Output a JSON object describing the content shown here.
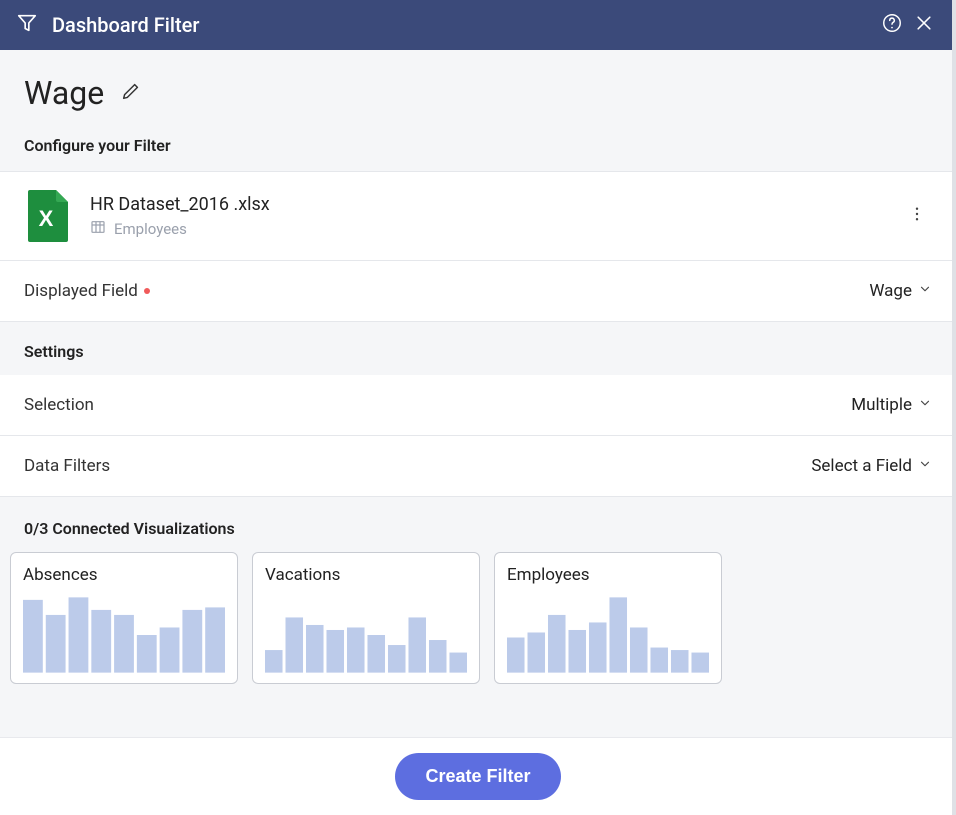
{
  "header": {
    "title": "Dashboard Filter"
  },
  "filter": {
    "name": "Wage",
    "configure_label": "Configure your Filter"
  },
  "data_source": {
    "filename": "HR Dataset_2016 .xlsx",
    "sheet": "Employees"
  },
  "displayed_field": {
    "label": "Displayed Field",
    "value": "Wage"
  },
  "settings": {
    "header": "Settings",
    "selection": {
      "label": "Selection",
      "value": "Multiple"
    },
    "data_filters": {
      "label": "Data Filters",
      "value": "Select a Field"
    }
  },
  "visualizations": {
    "header": "0/3 Connected Visualizations",
    "cards": [
      {
        "title": "Absences",
        "bars": [
          58,
          46,
          60,
          50,
          46,
          30,
          36,
          50,
          52
        ]
      },
      {
        "title": "Vacations",
        "bars": [
          18,
          44,
          38,
          34,
          36,
          30,
          22,
          44,
          26,
          16
        ]
      },
      {
        "title": "Employees",
        "bars": [
          28,
          32,
          46,
          34,
          40,
          60,
          36,
          20,
          18,
          16
        ]
      }
    ]
  },
  "footer": {
    "create_label": "Create Filter"
  },
  "icons": {
    "filter": "filter-icon",
    "help": "help-icon",
    "close": "close-icon",
    "edit": "pencil-icon",
    "more": "more-icon",
    "chevron": "chevron-down-icon",
    "sheet": "table-icon",
    "excel": "excel-file-icon"
  },
  "colors": {
    "header_bg": "#3b4a7a",
    "primary_button": "#5d6ee0",
    "bar_fill": "#bccbea",
    "excel_green": "#1e8e3e"
  }
}
